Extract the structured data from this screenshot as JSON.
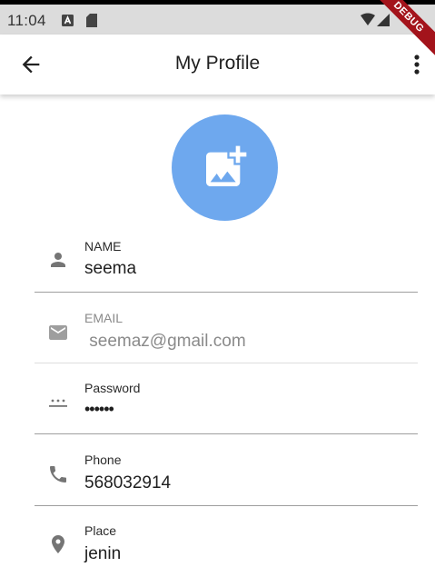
{
  "status_bar": {
    "time": "11:04",
    "debug_label": "DEBUG"
  },
  "app_bar": {
    "title": "My Profile"
  },
  "fields": {
    "name": {
      "label": "NAME",
      "value": "seema"
    },
    "email": {
      "label": "EMAIL",
      "value": " seemaz@gmail.com"
    },
    "password": {
      "label": "Password",
      "value": "••••••"
    },
    "phone": {
      "label": "Phone",
      "value": "568032914"
    },
    "place": {
      "label": "Place",
      "value": "jenin"
    }
  },
  "colors": {
    "avatar_bg": "#6ea8ee",
    "debug_ribbon": "#a3131b",
    "icon_gray": "#757575"
  },
  "icons": {
    "back": "arrow-back-icon",
    "overflow": "more-vert-icon",
    "avatar": "add-photo-icon",
    "name": "person-icon",
    "email": "mail-icon",
    "password": "password-icon",
    "phone": "phone-icon",
    "place": "location-pin-icon"
  }
}
